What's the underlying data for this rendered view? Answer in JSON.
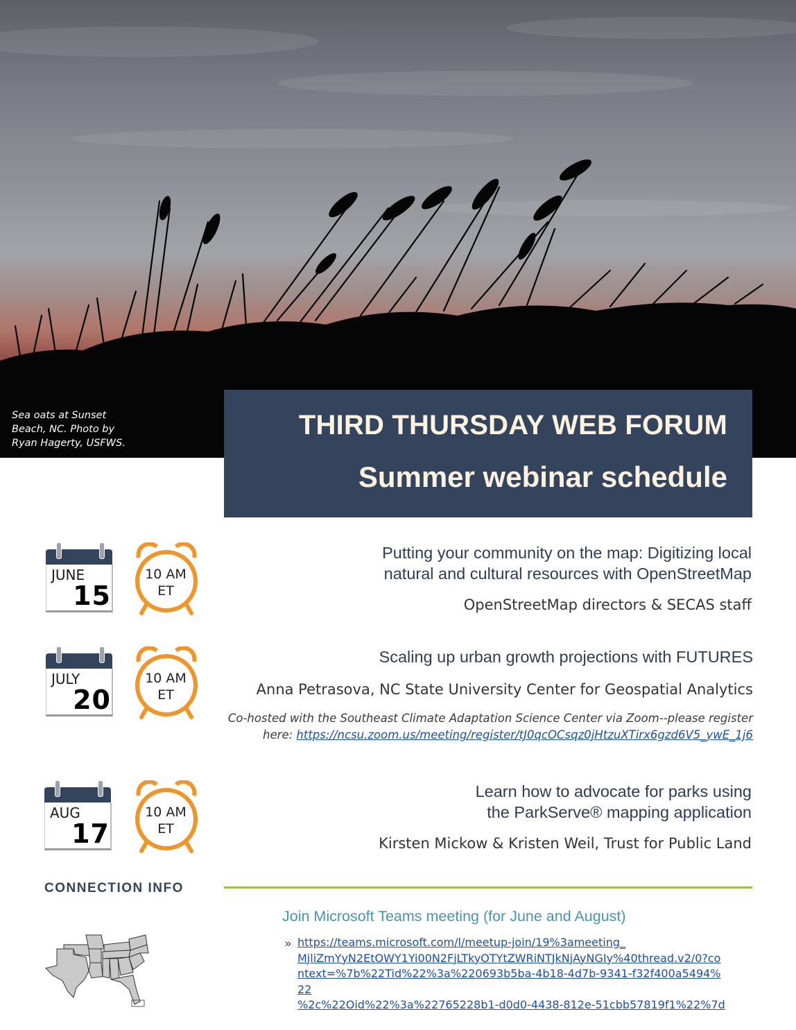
{
  "photo": {
    "caption_lines": [
      "Sea oats at Sunset",
      "Beach, NC. Photo by",
      "Ryan Hagerty, USFWS."
    ]
  },
  "header": {
    "title": "THIRD THURSDAY WEB FORUM",
    "subtitle": "Summer webinar schedule"
  },
  "events": [
    {
      "month": "JUNE",
      "day": "15",
      "time_line1": "10 AM",
      "time_line2": "ET",
      "title_lines": [
        "Putting your community on the map: Digitizing local",
        "natural and cultural resources with OpenStreetMap"
      ],
      "speaker": "OpenStreetMap directors & SECAS staff"
    },
    {
      "month": "JULY",
      "day": "20",
      "time_line1": "10 AM",
      "time_line2": "ET",
      "title_lines": [
        "Scaling up urban growth projections with FUTURES"
      ],
      "speaker": "Anna Petrasova, NC State University Center for Geospatial Analytics",
      "note_line1": "Co-hosted with the Southeast Climate Adaptation Science Center via Zoom--please register",
      "note_prefix": "here: ",
      "note_link": "https://ncsu.zoom.us/meeting/register/tJ0qcOCsqz0jHtzuXTirx6gzd6V5_ywE_1j6"
    },
    {
      "month": "AUG",
      "day": "17",
      "time_line1": "10 AM",
      "time_line2": "ET",
      "title_lines": [
        "Learn how to advocate for parks using",
        "the ParkServe® mapping application"
      ],
      "speaker": "Kirsten Mickow & Kristen Weil, Trust for Public Land"
    }
  ],
  "connection": {
    "heading": "CONNECTION INFO",
    "teams_heading": "Join Microsoft Teams meeting (for June and August)",
    "bullet": "»",
    "teams_link_lines": [
      "https://teams.microsoft.com/l/meetup-join/19%3ameeting_",
      "MjliZmYyN2EtOWY1Yi00N2FjLTkyOTYtZWRiNTJkNjAyNGIy%40thread.v2/0?co",
      "ntext=%7b%22Tid%22%3a%220693b5ba-4b18-4d7b-9341-f32f400a5494%22",
      "%2c%22Oid%22%3a%22765228b1-d0d0-4438-812e-51cbb57819f1%22%7d"
    ]
  },
  "icons": {
    "calendar": "calendar-icon",
    "clock": "alarm-clock-icon",
    "map": "southeast-us-map-icon"
  },
  "colors": {
    "navy": "#33445c",
    "cream": "#fbf3df",
    "orange": "#f0952a",
    "green_rule": "#9cc24a",
    "teams_blue": "#4596b5",
    "link_blue": "#1a4fb3"
  }
}
